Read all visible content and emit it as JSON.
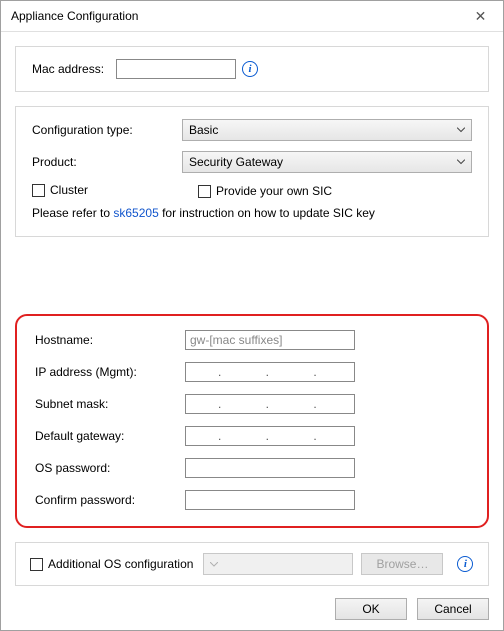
{
  "window": {
    "title": "Appliance Configuration"
  },
  "section_mac": {
    "label": "Mac address:",
    "value": ""
  },
  "section_config": {
    "config_type_label": "Configuration type:",
    "config_type_value": "Basic",
    "product_label": "Product:",
    "product_value": "Security Gateway",
    "cluster_label": "Cluster",
    "provide_sic_label": "Provide your own SIC",
    "note_prefix": "Please refer to ",
    "note_link_text": "sk65205",
    "note_suffix": " for instruction on how to update SIC key"
  },
  "section_net": {
    "hostname_label": "Hostname:",
    "hostname_value": "gw-[mac suffixes]",
    "ip_label": "IP address (Mgmt):",
    "ip_value": "      .          .          .       ",
    "subnet_label": "Subnet mask:",
    "subnet_value": "      .          .          .       ",
    "gateway_label": "Default gateway:",
    "gateway_value": "      .          .          .       ",
    "os_pw_label": "OS password:",
    "os_pw_value": "",
    "confirm_pw_label": "Confirm password:",
    "confirm_pw_value": ""
  },
  "section_additional": {
    "checkbox_label": "Additional OS configuration",
    "browse_label": "Browse…"
  },
  "footer": {
    "ok_label": "OK",
    "cancel_label": "Cancel"
  },
  "icons": {
    "close": "✕"
  }
}
